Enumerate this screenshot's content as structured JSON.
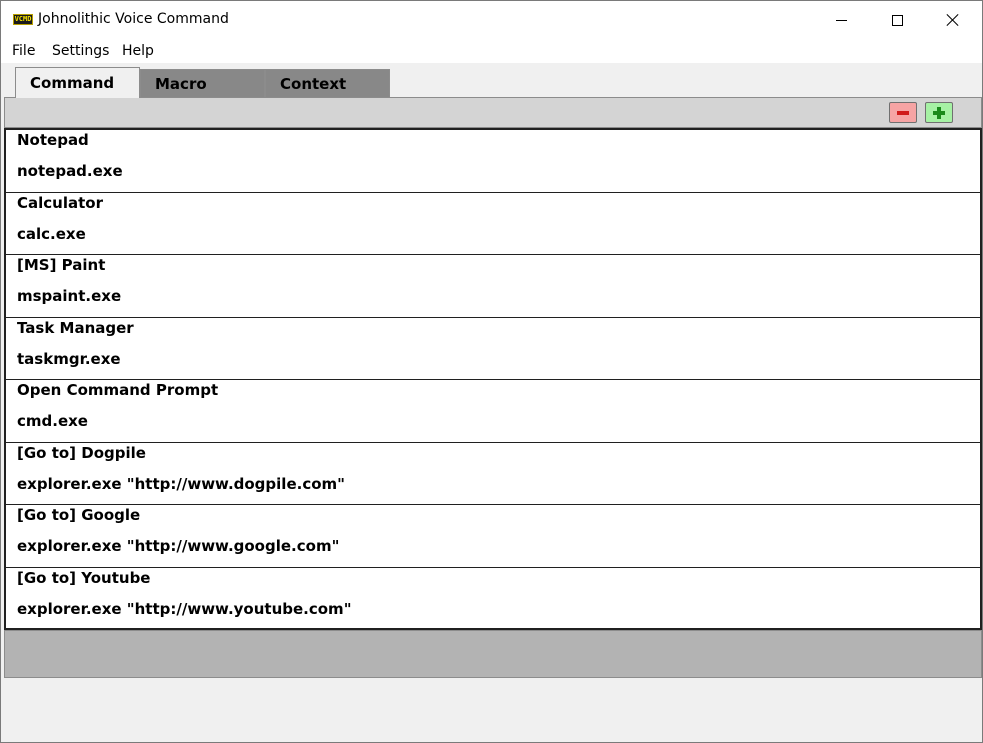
{
  "window": {
    "title": "Johnolithic Voice Command",
    "icon_text": "VCMD",
    "controls": {
      "minimize": "minimize-icon",
      "maximize": "maximize-icon",
      "close": "close-icon"
    }
  },
  "menu": {
    "file": "File",
    "settings": "Settings",
    "help": "Help"
  },
  "tabs": [
    {
      "label": "Command",
      "selected": true
    },
    {
      "label": "Macro",
      "selected": false
    },
    {
      "label": "Context",
      "selected": false
    }
  ],
  "toolbar": {
    "remove_icon": "minus-icon",
    "add_icon": "plus-icon"
  },
  "commands": [
    {
      "name": "Notepad",
      "command": "notepad.exe"
    },
    {
      "name": "Calculator",
      "command": "calc.exe"
    },
    {
      "name": "[MS] Paint",
      "command": "mspaint.exe"
    },
    {
      "name": "Task Manager",
      "command": "taskmgr.exe"
    },
    {
      "name": "Open Command Prompt",
      "command": "cmd.exe"
    },
    {
      "name": "[Go to] Dogpile",
      "command": "explorer.exe \"http://www.dogpile.com\""
    },
    {
      "name": "[Go to] Google",
      "command": "explorer.exe \"http://www.google.com\""
    },
    {
      "name": "[Go to] Youtube",
      "command": "explorer.exe \"http://www.youtube.com\""
    }
  ],
  "colors": {
    "remove_button": "#f6a4a4",
    "add_button": "#a6f1a4",
    "inactive_tab": "#888888",
    "status_band": "#b3b3b3"
  }
}
